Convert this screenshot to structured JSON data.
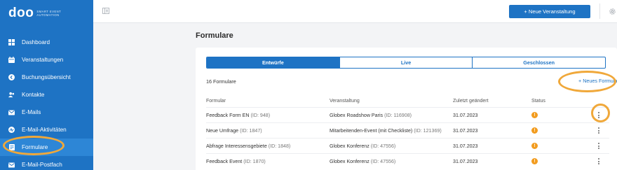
{
  "app": {
    "logo_text": "doo",
    "logo_subtitle": "SMART EVENT AUTOMATION"
  },
  "sidebar": {
    "items": [
      {
        "label": "Dashboard",
        "icon": "dashboard-icon"
      },
      {
        "label": "Veranstaltungen",
        "icon": "calendar-icon"
      },
      {
        "label": "Buchungsübersicht",
        "icon": "arrow-circle-icon"
      },
      {
        "label": "Kontakte",
        "icon": "contacts-icon"
      },
      {
        "label": "E-Mails",
        "icon": "mail-icon"
      },
      {
        "label": "E-Mail-Aktivitäten",
        "icon": "activity-icon"
      },
      {
        "label": "Formulare",
        "icon": "form-icon",
        "active": true
      },
      {
        "label": "E-Mail-Postfach",
        "icon": "inbox-icon"
      }
    ]
  },
  "topbar": {
    "new_event_label": "+ Neue Veranstaltung"
  },
  "main": {
    "page_title": "Formulare",
    "tabs": [
      {
        "label": "Entwürfe",
        "active": true
      },
      {
        "label": "Live",
        "active": false
      },
      {
        "label": "Geschlossen",
        "active": false
      }
    ],
    "count_text": "16 Formulare",
    "new_form_label": "+ Neues Formular",
    "columns": [
      "Formular",
      "Veranstaltung",
      "Zuletzt geändert",
      "Status"
    ],
    "rows": [
      {
        "name": "Feedback Form EN",
        "name_id": "(ID: 948)",
        "event": "Globex Roadshow Paris",
        "event_id": "(ID: 116908)",
        "date": "31.07.2023",
        "status": "!"
      },
      {
        "name": "Neue Umfrage",
        "name_id": "(ID: 1847)",
        "event": "Mitarbeitenden-Event (mit Checkliste)",
        "event_id": "(ID: 121369)",
        "date": "31.07.2023",
        "status": "!"
      },
      {
        "name": "Abfrage Interessensgebiete",
        "name_id": "(ID: 1848)",
        "event": "Globex Konferenz",
        "event_id": "(ID: 47556)",
        "date": "31.07.2023",
        "status": "!"
      },
      {
        "name": "Feedback Event",
        "name_id": "(ID: 1870)",
        "event": "Globex Konferenz",
        "event_id": "(ID: 47556)",
        "date": "31.07.2023",
        "status": "!"
      }
    ]
  },
  "colors": {
    "brand": "#1e73c4",
    "highlight": "#f0a83a",
    "status_warning": "#f29c1f"
  }
}
